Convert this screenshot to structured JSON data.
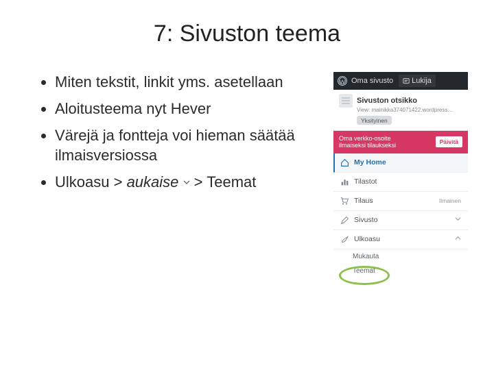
{
  "title": "7: Sivuston teema",
  "bullets": [
    "Miten tekstit, linkit yms. asetellaan",
    "Aloitusteema nyt Hever",
    "Värejä ja fontteja voi hieman säätää ilmaisversiossa"
  ],
  "bullet4": {
    "a": "Ulkoasu > ",
    "b_italic": "aukaise",
    "c": " > Teemat"
  },
  "wp": {
    "topbar": {
      "site_label": "Oma sivusto",
      "reader_label": "Lukija"
    },
    "site": {
      "title": "Sivuston otsikko",
      "sub": "View: mainikka374071422.wordpress…",
      "privacy": "Yksityinen"
    },
    "banner": {
      "line1": "Oma verkko-osoite",
      "line2": "ilmaiseksi tilaukseksi",
      "button": "Päivitä"
    },
    "nav": {
      "home": "My Home",
      "stats": "Tilastot",
      "plan": "Tilaus",
      "plan_meta": "Ilmainen",
      "site": "Sivusto",
      "appearance": "Ulkoasu",
      "sub_customize": "Mukauta",
      "sub_themes": "Teemat"
    }
  }
}
